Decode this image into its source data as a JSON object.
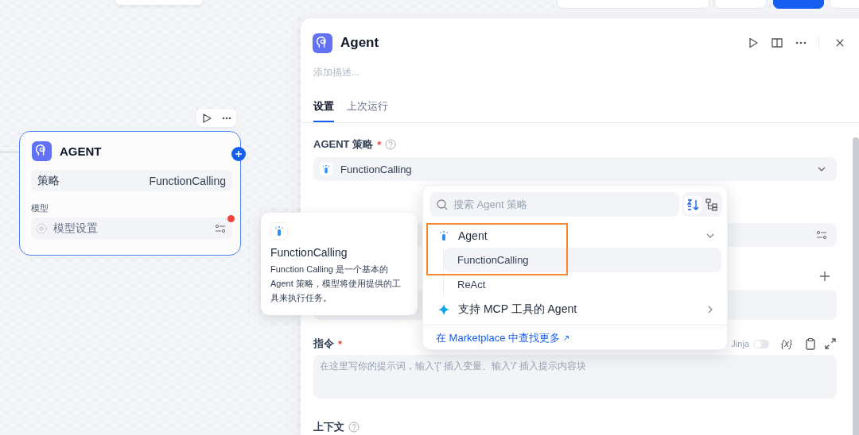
{
  "canvas": {
    "node": {
      "title": "AGENT",
      "selected": true,
      "strategy_label": "策略",
      "strategy_value": "FunctionCalling",
      "model_label": "模型",
      "model_value": "模型设置",
      "model_warning": true
    }
  },
  "tooltip": {
    "title": "FunctionCalling",
    "description": "Function Calling 是一个基本的 Agent 策略，模型将使用提供的工具来执行任务。"
  },
  "panel": {
    "title": "Agent",
    "description_placeholder": "添加描述...",
    "tabs": [
      {
        "label": "设置",
        "selected": true
      },
      {
        "label": "上次运行",
        "selected": false
      }
    ],
    "strategy": {
      "label": "AGENT 策略",
      "required": true,
      "required_mark": "*",
      "value": "FunctionCalling"
    },
    "instruction": {
      "label": "指令",
      "required": true,
      "required_mark": "*",
      "jinja_label": "Jinja",
      "jinja_on": false,
      "variable_button": "{x}",
      "placeholder": "在这里写你的提示词，输入'{' 插入变量、输入'/' 插入提示内容块"
    },
    "context": {
      "label": "上下文"
    }
  },
  "dropdown": {
    "search_placeholder": "搜索 Agent 策略",
    "groups": [
      {
        "label": "Agent",
        "kind": "tool",
        "expanded": true,
        "highlighted": true,
        "children": [
          {
            "label": "FunctionCalling",
            "selected": true
          },
          {
            "label": "ReAct",
            "selected": false
          }
        ]
      },
      {
        "label": "支持 MCP 工具的 Agent",
        "kind": "sparkle",
        "expanded": false,
        "highlighted": false
      }
    ],
    "footer_link": "在 Marketplace 中查找更多"
  }
}
